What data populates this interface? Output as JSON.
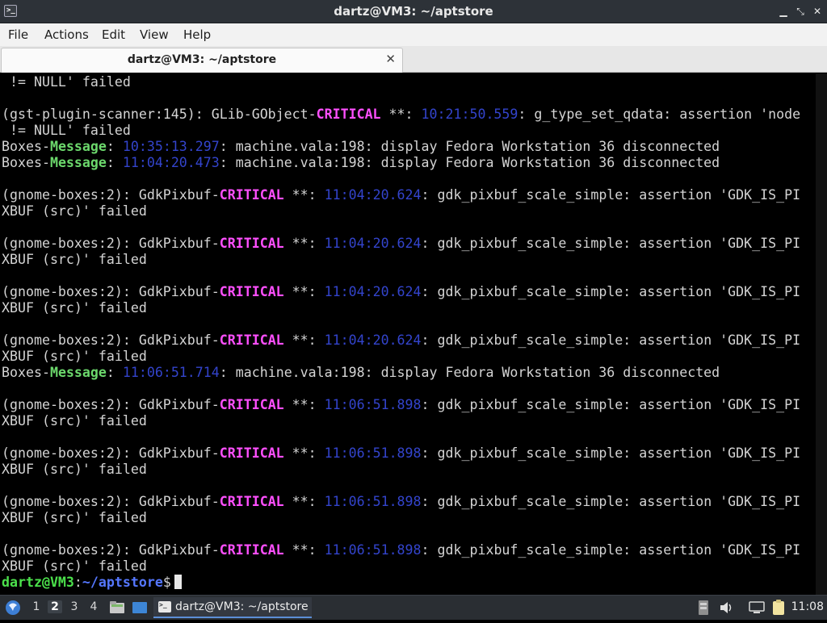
{
  "window": {
    "title": "dartz@VM3: ~/aptstore",
    "buttons": {
      "minimize": "▁",
      "maximize": "⤡",
      "close": "✕"
    }
  },
  "menu": [
    "File",
    "Actions",
    "Edit",
    "View",
    "Help"
  ],
  "tab": {
    "label": "dartz@VM3: ~/aptstore",
    "close": "✕"
  },
  "terminal": {
    "lines": [
      [
        {
          "t": " != NULL' failed"
        }
      ],
      [
        {
          "t": ""
        }
      ],
      [
        {
          "t": "(gst-plugin-scanner:145): GLib-GObject-"
        },
        {
          "t": "CRITICAL",
          "c": "crit"
        },
        {
          "t": " **: "
        },
        {
          "t": "10:21:50.559",
          "c": "ts"
        },
        {
          "t": ": g_type_set_qdata: assertion 'node"
        }
      ],
      [
        {
          "t": " != NULL' failed"
        }
      ],
      [
        {
          "t": "Boxes-"
        },
        {
          "t": "Message",
          "c": "msg"
        },
        {
          "t": ": "
        },
        {
          "t": "10:35:13.297",
          "c": "ts"
        },
        {
          "t": ": machine.vala:198: display Fedora Workstation 36 disconnected"
        }
      ],
      [
        {
          "t": "Boxes-"
        },
        {
          "t": "Message",
          "c": "msg"
        },
        {
          "t": ": "
        },
        {
          "t": "11:04:20.473",
          "c": "ts"
        },
        {
          "t": ": machine.vala:198: display Fedora Workstation 36 disconnected"
        }
      ],
      [
        {
          "t": ""
        }
      ],
      [
        {
          "t": "(gnome-boxes:2): GdkPixbuf-"
        },
        {
          "t": "CRITICAL",
          "c": "crit"
        },
        {
          "t": " **: "
        },
        {
          "t": "11:04:20.624",
          "c": "ts"
        },
        {
          "t": ": gdk_pixbuf_scale_simple: assertion 'GDK_IS_PI"
        }
      ],
      [
        {
          "t": "XBUF (src)' failed"
        }
      ],
      [
        {
          "t": ""
        }
      ],
      [
        {
          "t": "(gnome-boxes:2): GdkPixbuf-"
        },
        {
          "t": "CRITICAL",
          "c": "crit"
        },
        {
          "t": " **: "
        },
        {
          "t": "11:04:20.624",
          "c": "ts"
        },
        {
          "t": ": gdk_pixbuf_scale_simple: assertion 'GDK_IS_PI"
        }
      ],
      [
        {
          "t": "XBUF (src)' failed"
        }
      ],
      [
        {
          "t": ""
        }
      ],
      [
        {
          "t": "(gnome-boxes:2): GdkPixbuf-"
        },
        {
          "t": "CRITICAL",
          "c": "crit"
        },
        {
          "t": " **: "
        },
        {
          "t": "11:04:20.624",
          "c": "ts"
        },
        {
          "t": ": gdk_pixbuf_scale_simple: assertion 'GDK_IS_PI"
        }
      ],
      [
        {
          "t": "XBUF (src)' failed"
        }
      ],
      [
        {
          "t": ""
        }
      ],
      [
        {
          "t": "(gnome-boxes:2): GdkPixbuf-"
        },
        {
          "t": "CRITICAL",
          "c": "crit"
        },
        {
          "t": " **: "
        },
        {
          "t": "11:04:20.624",
          "c": "ts"
        },
        {
          "t": ": gdk_pixbuf_scale_simple: assertion 'GDK_IS_PI"
        }
      ],
      [
        {
          "t": "XBUF (src)' failed"
        }
      ],
      [
        {
          "t": "Boxes-"
        },
        {
          "t": "Message",
          "c": "msg"
        },
        {
          "t": ": "
        },
        {
          "t": "11:06:51.714",
          "c": "ts"
        },
        {
          "t": ": machine.vala:198: display Fedora Workstation 36 disconnected"
        }
      ],
      [
        {
          "t": ""
        }
      ],
      [
        {
          "t": "(gnome-boxes:2): GdkPixbuf-"
        },
        {
          "t": "CRITICAL",
          "c": "crit"
        },
        {
          "t": " **: "
        },
        {
          "t": "11:06:51.898",
          "c": "ts"
        },
        {
          "t": ": gdk_pixbuf_scale_simple: assertion 'GDK_IS_PI"
        }
      ],
      [
        {
          "t": "XBUF (src)' failed"
        }
      ],
      [
        {
          "t": ""
        }
      ],
      [
        {
          "t": "(gnome-boxes:2): GdkPixbuf-"
        },
        {
          "t": "CRITICAL",
          "c": "crit"
        },
        {
          "t": " **: "
        },
        {
          "t": "11:06:51.898",
          "c": "ts"
        },
        {
          "t": ": gdk_pixbuf_scale_simple: assertion 'GDK_IS_PI"
        }
      ],
      [
        {
          "t": "XBUF (src)' failed"
        }
      ],
      [
        {
          "t": ""
        }
      ],
      [
        {
          "t": "(gnome-boxes:2): GdkPixbuf-"
        },
        {
          "t": "CRITICAL",
          "c": "crit"
        },
        {
          "t": " **: "
        },
        {
          "t": "11:06:51.898",
          "c": "ts"
        },
        {
          "t": ": gdk_pixbuf_scale_simple: assertion 'GDK_IS_PI"
        }
      ],
      [
        {
          "t": "XBUF (src)' failed"
        }
      ],
      [
        {
          "t": ""
        }
      ],
      [
        {
          "t": "(gnome-boxes:2): GdkPixbuf-"
        },
        {
          "t": "CRITICAL",
          "c": "crit"
        },
        {
          "t": " **: "
        },
        {
          "t": "11:06:51.898",
          "c": "ts"
        },
        {
          "t": ": gdk_pixbuf_scale_simple: assertion 'GDK_IS_PI"
        }
      ],
      [
        {
          "t": "XBUF (src)' failed"
        }
      ]
    ],
    "prompt": {
      "user_host": "dartz@VM3",
      "sep": ":",
      "path": "~/aptstore",
      "symbol": "$"
    }
  },
  "taskbar": {
    "workspaces": [
      "1",
      "2",
      "3",
      "4"
    ],
    "active_workspace": "2",
    "task_label": "dartz@VM3: ~/aptstore",
    "clock": "11:08",
    "tray_icons": [
      "network-icon",
      "volume-icon",
      "display-icon",
      "clipboard-icon"
    ]
  },
  "colors": {
    "critical": "#ff4fff",
    "message": "#6cd86c",
    "timestamp": "#3344cc",
    "prompt_user": "#4be04b",
    "prompt_path": "#5577ff"
  }
}
